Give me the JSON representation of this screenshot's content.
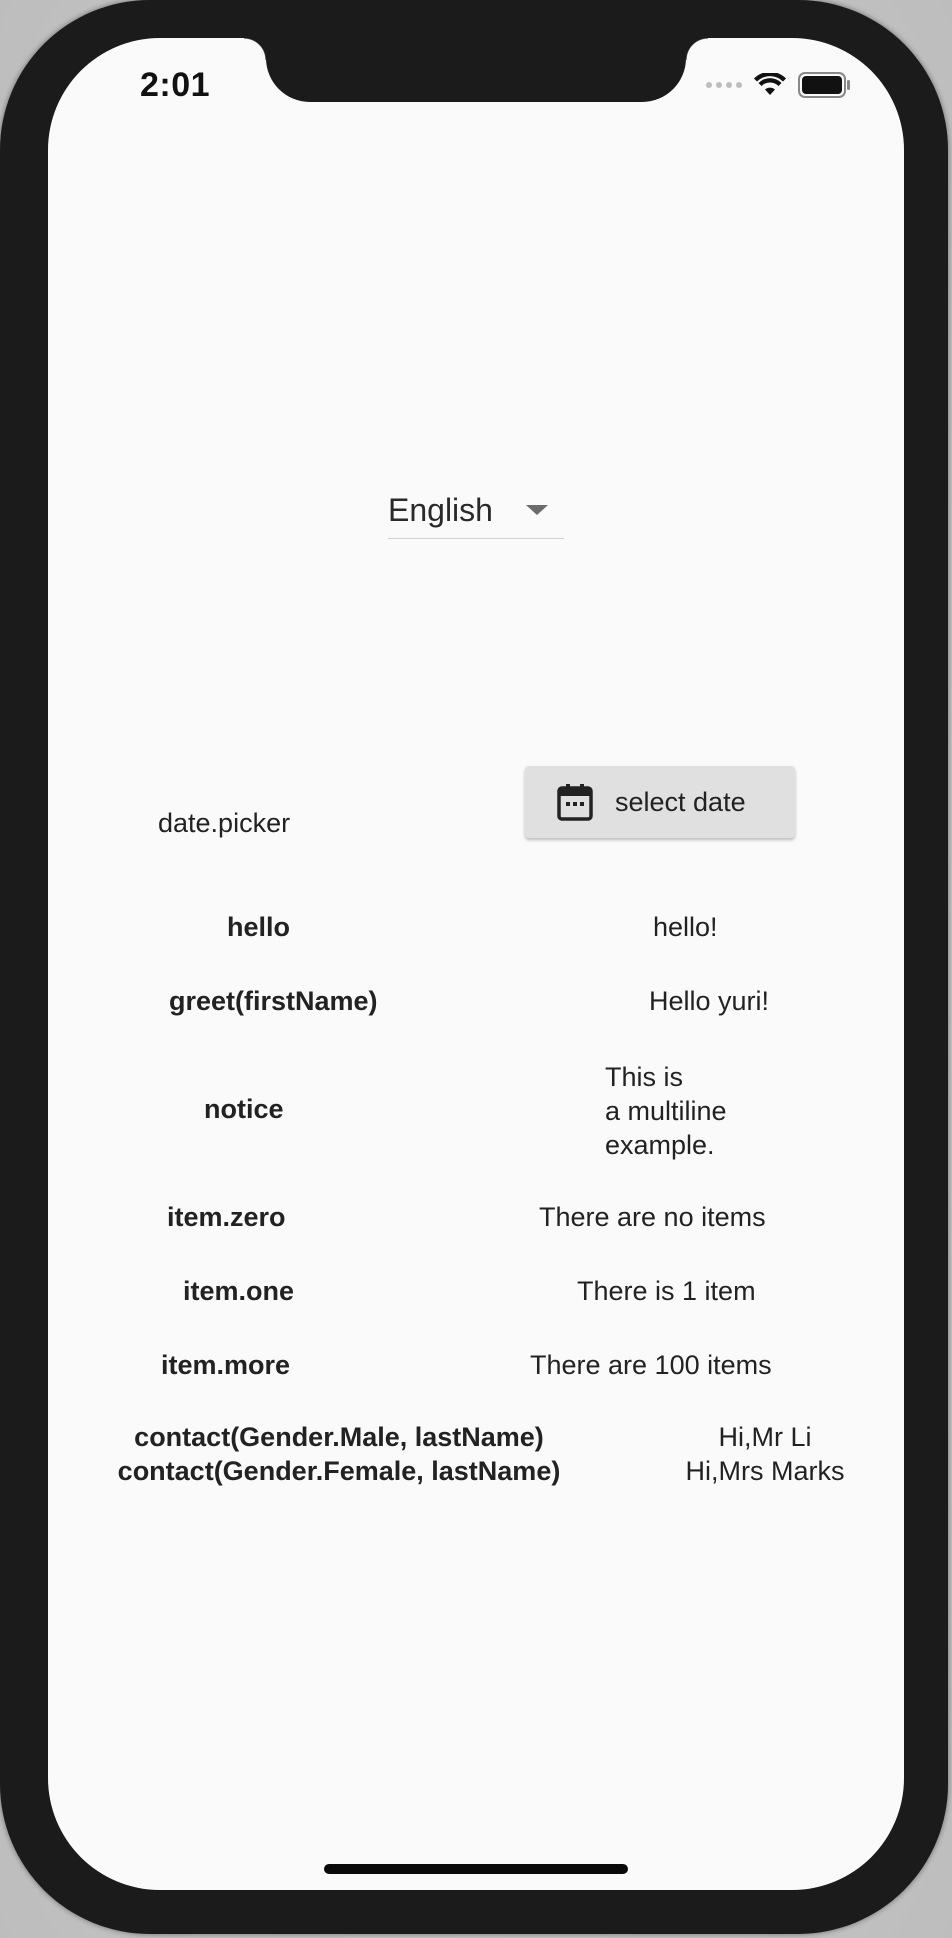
{
  "status_bar": {
    "time": "2:01"
  },
  "language_dropdown": {
    "selected": "English"
  },
  "date_picker": {
    "label": "date.picker",
    "button_label": "select date"
  },
  "rows": {
    "hello": {
      "key": "hello",
      "value": "hello!"
    },
    "greet": {
      "key": "greet(firstName)",
      "value": "Hello yuri!"
    },
    "notice": {
      "key": "notice",
      "value_lines": [
        "This is",
        "a multiline",
        "example."
      ]
    },
    "item_zero": {
      "key": "item.zero",
      "value": "There are no items"
    },
    "item_one": {
      "key": "item.one",
      "value": "There is 1 item"
    },
    "item_more": {
      "key": "item.more",
      "value": "There are 100 items"
    },
    "contact": {
      "key_lines": [
        "contact(Gender.Male, lastName)",
        "contact(Gender.Female, lastName)"
      ],
      "value_lines": [
        "Hi,Mr Li",
        "Hi,Mrs Marks"
      ]
    }
  },
  "icons": {
    "wifi": "wifi-icon",
    "battery": "battery-icon",
    "signal": "signal-icon",
    "calendar": "calendar-icon",
    "dropdown": "caret-down-icon"
  }
}
